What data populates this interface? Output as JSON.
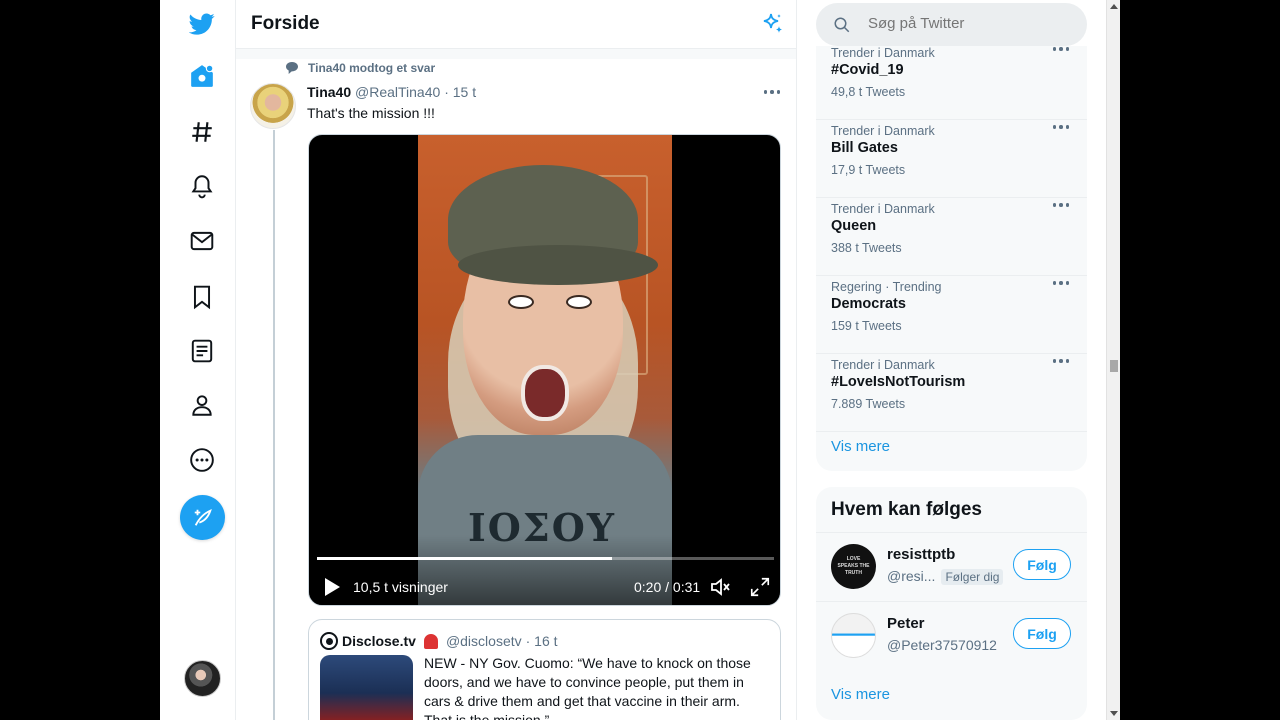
{
  "feed": {
    "title": "Forside",
    "context": "Tina40 modtog et svar"
  },
  "tweet": {
    "name": "Tina40",
    "handle": "@RealTina40",
    "time": "· 15 t",
    "text": "That's the mission !!!",
    "video": {
      "views": "10,5 t visninger",
      "time": "0:20 / 0:31",
      "progress": 0.645,
      "shirt_text": "ΙΟΣΟΥ"
    }
  },
  "quote": {
    "name": "Disclose.tv",
    "handle": "@disclosetv",
    "time": "· 16 t",
    "text": "NEW - NY Gov. Cuomo: “We have to knock on those doors, and we have to convince people, put them in cars & drive them and get that vaccine in their arm. That is the mission.”"
  },
  "search": {
    "placeholder": "Søg på Twitter"
  },
  "trends": [
    {
      "context": "Trender i Danmark",
      "title": "#Covid_19",
      "count": "49,8 t Tweets"
    },
    {
      "context": "Trender i Danmark",
      "title": "Bill Gates",
      "count": "17,9 t Tweets"
    },
    {
      "context": "Trender i Danmark",
      "title": "Queen",
      "count": "388 t Tweets"
    },
    {
      "context": "Regering · Trending",
      "title": "Democrats",
      "count": "159 t Tweets"
    },
    {
      "context": "Trender i Danmark",
      "title": "#LoveIsNotTourism",
      "count": "7.889 Tweets"
    }
  ],
  "trends_more": "Vis mere",
  "who_to_follow": {
    "title": "Hvem kan følges",
    "items": [
      {
        "name": "resisttptb",
        "handle": "@resi...",
        "badge": "Følger dig",
        "button": "Følg",
        "avatar_text": "LOVE SPEAKS THE TRUTH"
      },
      {
        "name": "Peter",
        "handle": "@Peter37570912",
        "badge": "",
        "button": "Følg"
      }
    ],
    "more": "Vis mere"
  },
  "colors": {
    "accent": "#1da1f2",
    "secondary_text": "#5b7083",
    "panel_bg": "#f7f9fa"
  }
}
